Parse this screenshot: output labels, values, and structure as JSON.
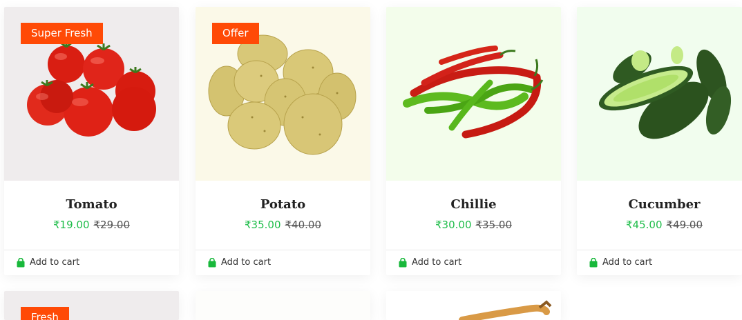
{
  "currency_symbol": "₹",
  "colors": {
    "accent": "#1fbd4a",
    "badge": "#ff4a06"
  },
  "products": [
    {
      "name": "Tomato",
      "badge": "Super Fresh",
      "price": "₹19.00",
      "old_price": "₹29.00",
      "cart_label": "Add to cart",
      "image_bg": "#efeced"
    },
    {
      "name": "Potato",
      "badge": "Offer",
      "price": "₹35.00",
      "old_price": "₹40.00",
      "cart_label": "Add to cart",
      "image_bg": "#fbf9e8"
    },
    {
      "name": "Chillie",
      "badge": "",
      "price": "₹30.00",
      "old_price": "₹35.00",
      "cart_label": "Add to cart",
      "image_bg": "#f3fdeb"
    },
    {
      "name": "Cucumber",
      "badge": "",
      "price": "₹45.00",
      "old_price": "₹49.00",
      "cart_label": "Add to cart",
      "image_bg": "#f1fdee"
    }
  ],
  "second_row": [
    {
      "badge": "Fresh"
    },
    {
      "badge": ""
    },
    {
      "badge": ""
    }
  ],
  "icons": {
    "cart": "shopping-bag-icon"
  }
}
